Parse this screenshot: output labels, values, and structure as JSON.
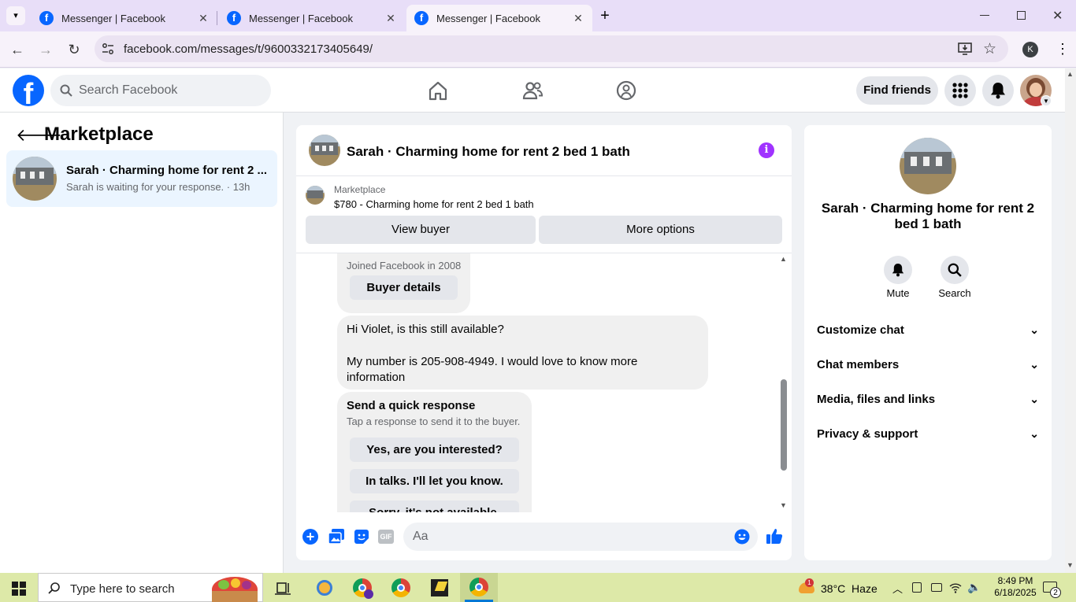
{
  "browser": {
    "tabs": [
      {
        "title": "Messenger | Facebook"
      },
      {
        "title": "Messenger | Facebook"
      },
      {
        "title": "Messenger | Facebook"
      }
    ],
    "url": "facebook.com/messages/t/9600332173405649/",
    "profile_initial": "K"
  },
  "fb_header": {
    "search_placeholder": "Search Facebook",
    "find_friends": "Find friends",
    "logo": "f"
  },
  "left_pane": {
    "title": "Marketplace",
    "conversation": {
      "name": "Sarah · Charming home for rent 2 ...",
      "preview": "Sarah is waiting for your response. · 13h"
    }
  },
  "chat": {
    "title": "Sarah · Charming home for rent 2 bed 1 bath",
    "info_icon": "i",
    "marketplace_label": "Marketplace",
    "listing": "$780 - Charming home for rent 2 bed 1 bath",
    "view_buyer": "View buyer",
    "more_options": "More options",
    "joined": "Joined Facebook in 2008",
    "buyer_details": "Buyer details",
    "message_line1": "Hi Violet, is this still available?",
    "message_line2": "My number is 205-908-4949. I would love to know more information",
    "quick_title": "Send a quick response",
    "quick_sub": "Tap a response to send it to the buyer.",
    "quick_responses": [
      "Yes, are you interested?",
      "In talks. I'll let you know.",
      "Sorry, it's not available."
    ],
    "composer_placeholder": "Aa",
    "gif_label": "GIF"
  },
  "right_pane": {
    "name": "Sarah · Charming home for rent 2 bed 1 bath",
    "mute": "Mute",
    "search": "Search",
    "sections": [
      "Customize chat",
      "Chat members",
      "Media, files and links",
      "Privacy & support"
    ]
  },
  "taskbar": {
    "search_placeholder": "Type here to search",
    "weather": "38°C  Haze",
    "weather_badge": "1",
    "time": "8:49 PM",
    "date": "6/18/2025",
    "notifications": "2"
  },
  "colors": {
    "fb_blue": "#0866ff",
    "accent_purple": "#a033ff",
    "chrome_tabbar": "#e8def8",
    "taskbar": "#dde9a8"
  }
}
